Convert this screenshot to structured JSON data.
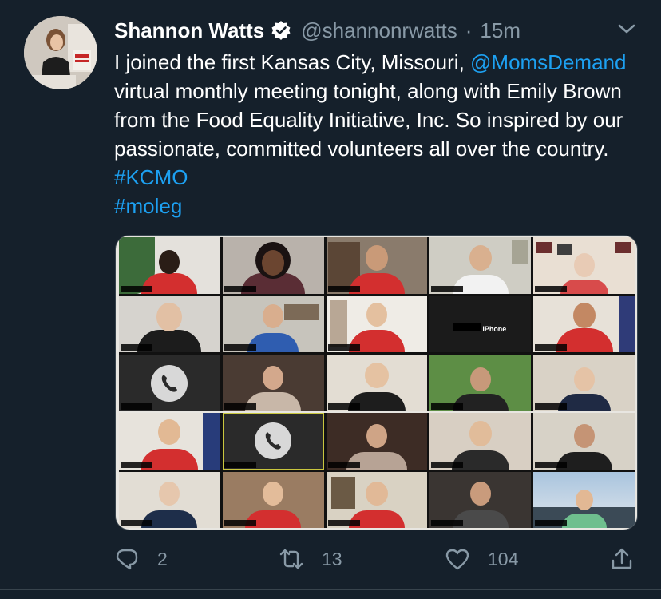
{
  "tweet": {
    "author_name": "Shannon Watts",
    "author_handle": "@shannonrwatts",
    "separator": "·",
    "timestamp": "15m",
    "text_parts": [
      {
        "text": "I joined the first Kansas City, Missouri, ",
        "type": "text"
      },
      {
        "text": "@MomsDemand",
        "type": "mention"
      },
      {
        "text": " virtual monthly meeting tonight, along with Emily Brown from the Food Equality Initiative, Inc. So inspired by our passionate, committed volunteers all over the country. ",
        "type": "text"
      },
      {
        "text": "#KCMO",
        "type": "hashtag"
      },
      {
        "text": " ",
        "type": "text"
      },
      {
        "text": "#moleg",
        "type": "hashtag"
      }
    ],
    "media": {
      "iphone_label": "iPhone"
    },
    "actions": {
      "reply_count": "2",
      "retweet_count": "13",
      "like_count": "104"
    }
  },
  "colors": {
    "background": "#15202b",
    "link": "#1da1f2",
    "muted": "#8899a6"
  },
  "icons": [
    "verified-badge-icon",
    "chevron-down-icon",
    "reply-icon",
    "retweet-icon",
    "like-icon",
    "share-icon",
    "phone-icon"
  ]
}
